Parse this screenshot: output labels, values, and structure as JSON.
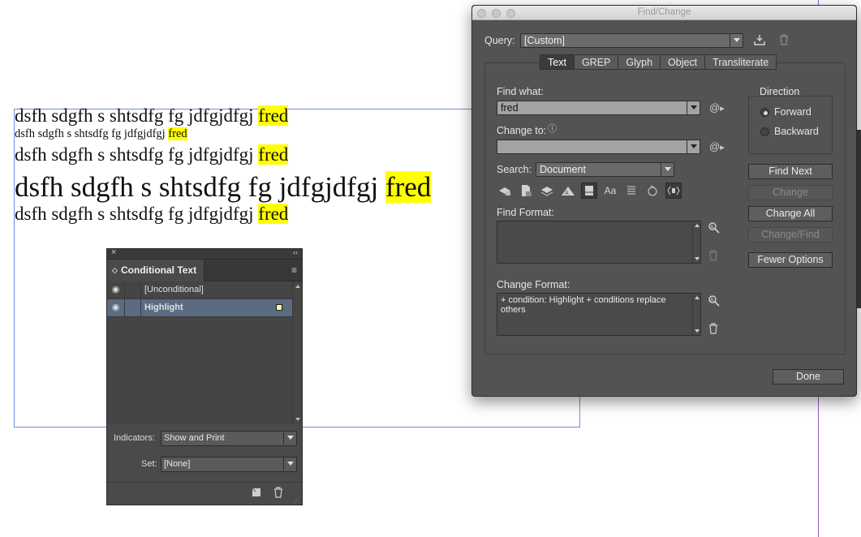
{
  "document": {
    "lines": [
      {
        "text": "dsfh sdgfh s shtsdfg fg jdfgjdfgj ",
        "highlight": "fred"
      },
      {
        "text": "dsfh sdgfh s shtsdfg fg jdfgjdfgj ",
        "highlight": "fred"
      },
      {
        "text": "dsfh sdgfh s shtsdfg fg jdfgjdfgj ",
        "highlight": "fred"
      },
      {
        "text": "dsfh sdgfh s shtsdfg fg jdfgjdfgj ",
        "highlight": "fred"
      },
      {
        "text": "dsfh sdgfh s shtsdfg fg jdfgjdfgj ",
        "highlight": "fred"
      }
    ],
    "highlight_color": "#ffff00"
  },
  "find_change": {
    "title": "Find/Change",
    "query_label": "Query:",
    "query_value": "[Custom]",
    "tabs": [
      "Text",
      "GREP",
      "Glyph",
      "Object",
      "Transliterate"
    ],
    "active_tab": "Text",
    "find_what_label": "Find what:",
    "find_what_value": "fred",
    "change_to_label": "Change to:",
    "change_to_value": "",
    "search_label": "Search:",
    "search_value": "Document",
    "direction_label": "Direction",
    "direction_forward": "Forward",
    "direction_backward": "Backward",
    "buttons": {
      "find_next": "Find Next",
      "change": "Change",
      "change_all": "Change All",
      "change_find": "Change/Find",
      "fewer_options": "Fewer Options",
      "done": "Done"
    },
    "option_icons": [
      "lock-layer-icon",
      "lock-story-icon",
      "hidden-layer-icon",
      "master-page-icon",
      "footnote-icon",
      "case-sensitive-icon",
      "whole-word-icon",
      "kana-sensitive-icon",
      "width-sensitive-icon"
    ],
    "case_glyph": "Aa",
    "find_format_label": "Find Format:",
    "find_format_value": "",
    "change_format_label": "Change Format:",
    "change_format_value": "+ condition: Highlight + conditions replace others"
  },
  "conditional_text": {
    "tab_label": "Conditional Text",
    "conditions": [
      {
        "name": "[Unconditional]",
        "selected": false
      },
      {
        "name": "Highlight",
        "selected": true,
        "swatch": "#ffff99"
      }
    ],
    "indicators_label": "Indicators:",
    "indicators_value": "Show and Print",
    "set_label": "Set:",
    "set_value": "[None]"
  }
}
